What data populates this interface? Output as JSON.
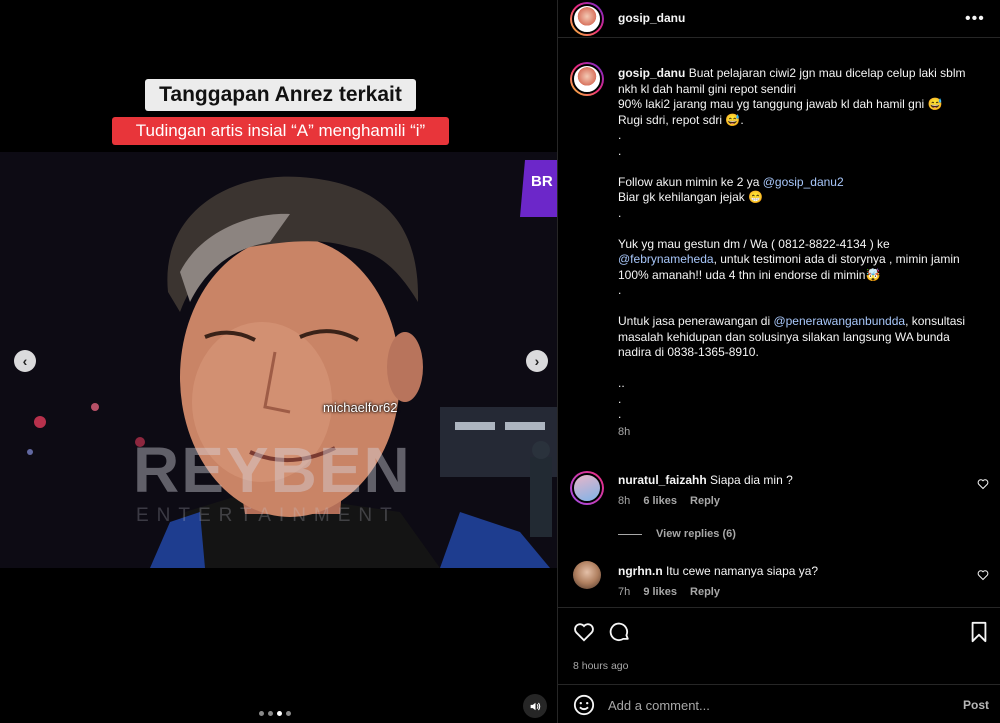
{
  "media": {
    "caption_title": "Tanggapan Anrez terkait",
    "caption_subtitle": "Tudingan artis insial “A” menghamili “i”",
    "handle_overlay": "michaelfor62",
    "watermark_main": "REYBEN",
    "watermark_sub": "ENTERTAINMENT",
    "slide_count": 4,
    "active_slide": 3
  },
  "post": {
    "username": "gosip_danu",
    "caption_lines": [
      "Buat pelajaran ciwi2 jgn mau dicelap celup laki sblm nkh kl dah hamil gini repot sendiri",
      "90% laki2 jarang mau yg tanggung jawab kl dah hamil gni 😅",
      "Rugi sdri, repot sdri 😅.",
      ".",
      ".",
      "",
      "Follow akun mimin ke 2 ya ",
      "Biar gk kehilangan jejak 😁",
      ".",
      "",
      "Yuk yg mau gestun dm / Wa ( 0812-8822-4134 ) ke ",
      "",
      "100% amanah!! uda 4 thn ini endorse di mimin🤯",
      ".",
      "",
      "Untuk jasa penerawangan di ",
      "masalah kehidupan dan solusinya silakan langsung WA bunda nadira di 0838-1365-8910.",
      "",
      "..",
      ".",
      ".",
      ""
    ],
    "mention_follow": "@gosip_danu2",
    "mention_gestun": "@febrynameheda",
    "gestun_tail": ", untuk testimoni ada di storynya , mimin jamin",
    "mention_penerawangan": "@penerawanganbundda",
    "penerawangan_tail": ", konsultasi",
    "caption_time": "8h",
    "posted_ago": "8 hours ago"
  },
  "comments": [
    {
      "username": "nuratul_faizahh",
      "text": "Siapa dia min ?",
      "time": "8h",
      "likes": "6 likes",
      "reply": "Reply",
      "view_replies": "View replies (6)"
    },
    {
      "username": "ngrhn.n",
      "text": "Itu cewe namanya siapa ya?",
      "time": "7h",
      "likes": "9 likes",
      "reply": "Reply"
    }
  ],
  "composer": {
    "placeholder": "Add a comment...",
    "post_label": "Post"
  },
  "colors": {
    "background": "#000000",
    "divider": "#262626",
    "muted_text": "#a8a8a8",
    "mention": "#a8c7fa",
    "red_banner": "#e8353a"
  },
  "icons": [
    "more-options-icon",
    "heart-icon",
    "comment-icon",
    "bookmark-icon",
    "emoji-icon",
    "speaker-icon",
    "chevron-left-icon",
    "chevron-right-icon"
  ]
}
